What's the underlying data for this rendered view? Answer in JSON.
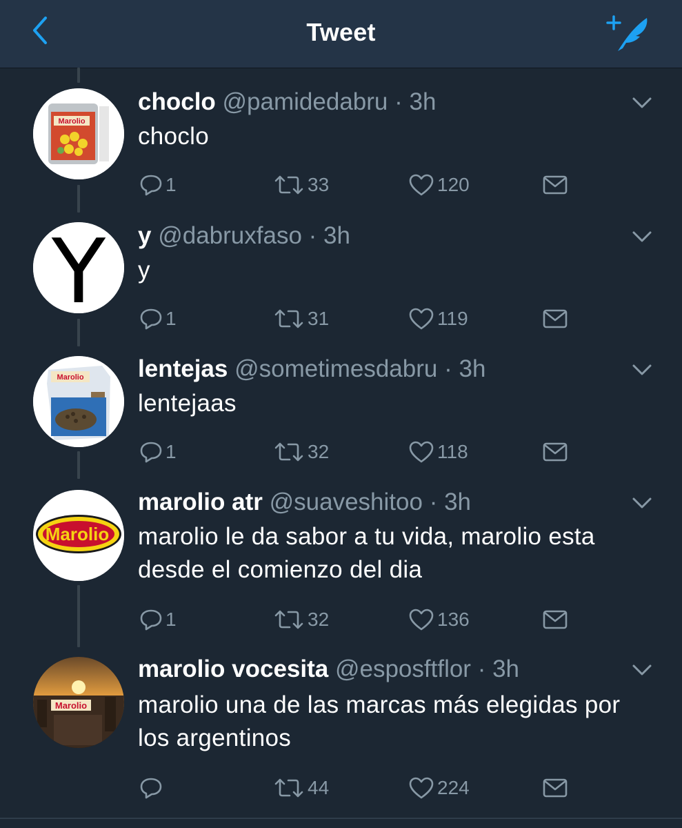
{
  "header": {
    "title": "Tweet",
    "back_icon": "chevron-left-icon",
    "compose_icon": "compose-tweet-icon",
    "accent_color": "#1da1f2"
  },
  "tweets": [
    {
      "name": "choclo",
      "handle": "@pamidedabru",
      "dot": "·",
      "time": "3h",
      "text": "choclo",
      "replies": "1",
      "retweets": "33",
      "likes": "120",
      "avatar_label": "Marolio"
    },
    {
      "name": "y",
      "handle": "@dabruxfaso",
      "dot": "·",
      "time": "3h",
      "text": "y",
      "replies": "1",
      "retweets": "31",
      "likes": "119",
      "avatar_label": "Y"
    },
    {
      "name": "lentejas",
      "handle": "@sometimesdabru",
      "dot": "·",
      "time": "3h",
      "text": "lentejaas",
      "replies": "1",
      "retweets": "32",
      "likes": "118",
      "avatar_label": "Marolio"
    },
    {
      "name": "marolio atr",
      "handle": "@suaveshitoo",
      "dot": "·",
      "time": "3h",
      "text": "marolio le da sabor a tu vida, marolio esta desde el comienzo del dia",
      "replies": "1",
      "retweets": "32",
      "likes": "136",
      "avatar_label": "Marolio"
    },
    {
      "name": "marolio vocesita",
      "handle": "@esposftflor",
      "dot": "·",
      "time": "3h",
      "text": "marolio una de las marcas más elegidas por los argentinos",
      "replies": "",
      "retweets": "44",
      "likes": "224",
      "avatar_label": "Marolio"
    }
  ]
}
